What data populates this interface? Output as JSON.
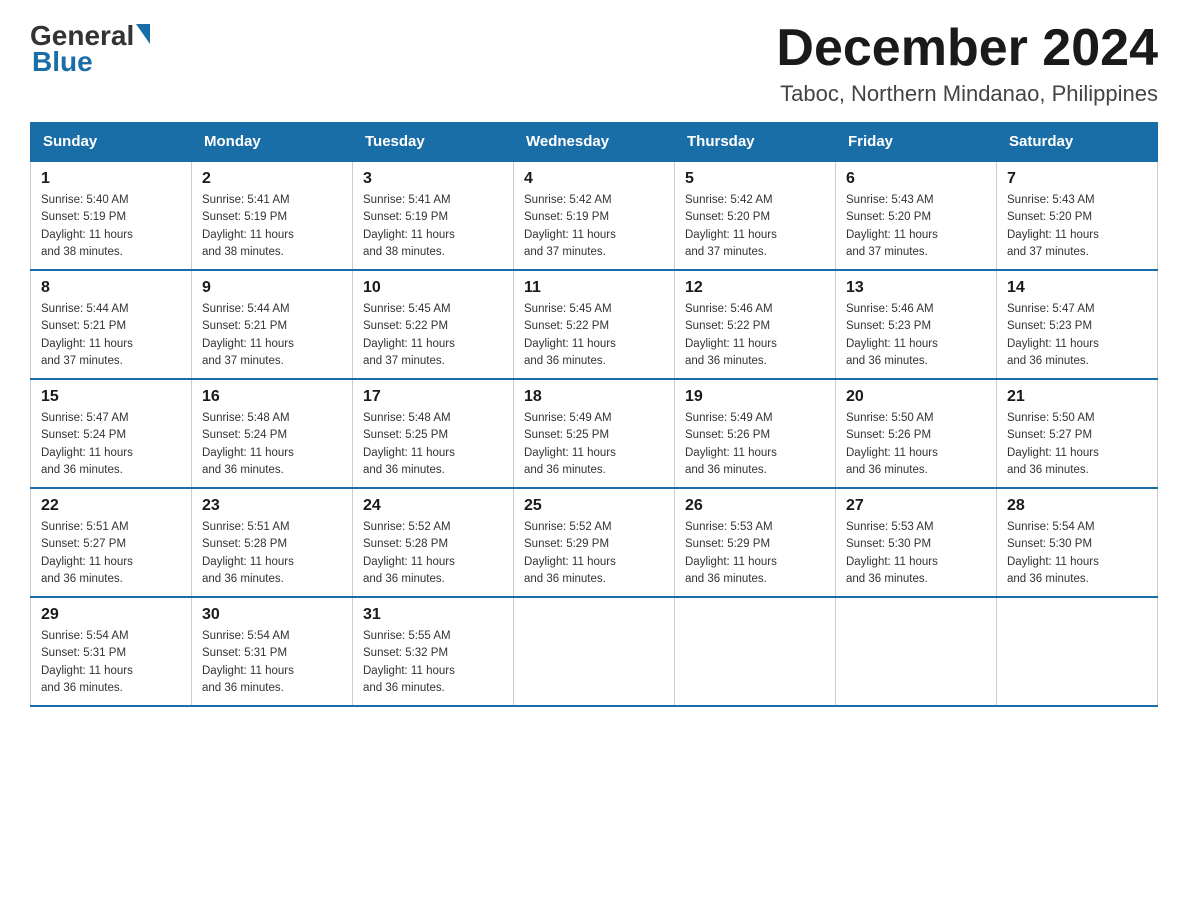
{
  "header": {
    "logo": {
      "general": "General",
      "blue": "Blue"
    },
    "title": "December 2024",
    "subtitle": "Taboc, Northern Mindanao, Philippines"
  },
  "calendar": {
    "days_of_week": [
      "Sunday",
      "Monday",
      "Tuesday",
      "Wednesday",
      "Thursday",
      "Friday",
      "Saturday"
    ],
    "weeks": [
      [
        {
          "day": "1",
          "sunrise": "5:40 AM",
          "sunset": "5:19 PM",
          "daylight": "11 hours and 38 minutes."
        },
        {
          "day": "2",
          "sunrise": "5:41 AM",
          "sunset": "5:19 PM",
          "daylight": "11 hours and 38 minutes."
        },
        {
          "day": "3",
          "sunrise": "5:41 AM",
          "sunset": "5:19 PM",
          "daylight": "11 hours and 38 minutes."
        },
        {
          "day": "4",
          "sunrise": "5:42 AM",
          "sunset": "5:19 PM",
          "daylight": "11 hours and 37 minutes."
        },
        {
          "day": "5",
          "sunrise": "5:42 AM",
          "sunset": "5:20 PM",
          "daylight": "11 hours and 37 minutes."
        },
        {
          "day": "6",
          "sunrise": "5:43 AM",
          "sunset": "5:20 PM",
          "daylight": "11 hours and 37 minutes."
        },
        {
          "day": "7",
          "sunrise": "5:43 AM",
          "sunset": "5:20 PM",
          "daylight": "11 hours and 37 minutes."
        }
      ],
      [
        {
          "day": "8",
          "sunrise": "5:44 AM",
          "sunset": "5:21 PM",
          "daylight": "11 hours and 37 minutes."
        },
        {
          "day": "9",
          "sunrise": "5:44 AM",
          "sunset": "5:21 PM",
          "daylight": "11 hours and 37 minutes."
        },
        {
          "day": "10",
          "sunrise": "5:45 AM",
          "sunset": "5:22 PM",
          "daylight": "11 hours and 37 minutes."
        },
        {
          "day": "11",
          "sunrise": "5:45 AM",
          "sunset": "5:22 PM",
          "daylight": "11 hours and 36 minutes."
        },
        {
          "day": "12",
          "sunrise": "5:46 AM",
          "sunset": "5:22 PM",
          "daylight": "11 hours and 36 minutes."
        },
        {
          "day": "13",
          "sunrise": "5:46 AM",
          "sunset": "5:23 PM",
          "daylight": "11 hours and 36 minutes."
        },
        {
          "day": "14",
          "sunrise": "5:47 AM",
          "sunset": "5:23 PM",
          "daylight": "11 hours and 36 minutes."
        }
      ],
      [
        {
          "day": "15",
          "sunrise": "5:47 AM",
          "sunset": "5:24 PM",
          "daylight": "11 hours and 36 minutes."
        },
        {
          "day": "16",
          "sunrise": "5:48 AM",
          "sunset": "5:24 PM",
          "daylight": "11 hours and 36 minutes."
        },
        {
          "day": "17",
          "sunrise": "5:48 AM",
          "sunset": "5:25 PM",
          "daylight": "11 hours and 36 minutes."
        },
        {
          "day": "18",
          "sunrise": "5:49 AM",
          "sunset": "5:25 PM",
          "daylight": "11 hours and 36 minutes."
        },
        {
          "day": "19",
          "sunrise": "5:49 AM",
          "sunset": "5:26 PM",
          "daylight": "11 hours and 36 minutes."
        },
        {
          "day": "20",
          "sunrise": "5:50 AM",
          "sunset": "5:26 PM",
          "daylight": "11 hours and 36 minutes."
        },
        {
          "day": "21",
          "sunrise": "5:50 AM",
          "sunset": "5:27 PM",
          "daylight": "11 hours and 36 minutes."
        }
      ],
      [
        {
          "day": "22",
          "sunrise": "5:51 AM",
          "sunset": "5:27 PM",
          "daylight": "11 hours and 36 minutes."
        },
        {
          "day": "23",
          "sunrise": "5:51 AM",
          "sunset": "5:28 PM",
          "daylight": "11 hours and 36 minutes."
        },
        {
          "day": "24",
          "sunrise": "5:52 AM",
          "sunset": "5:28 PM",
          "daylight": "11 hours and 36 minutes."
        },
        {
          "day": "25",
          "sunrise": "5:52 AM",
          "sunset": "5:29 PM",
          "daylight": "11 hours and 36 minutes."
        },
        {
          "day": "26",
          "sunrise": "5:53 AM",
          "sunset": "5:29 PM",
          "daylight": "11 hours and 36 minutes."
        },
        {
          "day": "27",
          "sunrise": "5:53 AM",
          "sunset": "5:30 PM",
          "daylight": "11 hours and 36 minutes."
        },
        {
          "day": "28",
          "sunrise": "5:54 AM",
          "sunset": "5:30 PM",
          "daylight": "11 hours and 36 minutes."
        }
      ],
      [
        {
          "day": "29",
          "sunrise": "5:54 AM",
          "sunset": "5:31 PM",
          "daylight": "11 hours and 36 minutes."
        },
        {
          "day": "30",
          "sunrise": "5:54 AM",
          "sunset": "5:31 PM",
          "daylight": "11 hours and 36 minutes."
        },
        {
          "day": "31",
          "sunrise": "5:55 AM",
          "sunset": "5:32 PM",
          "daylight": "11 hours and 36 minutes."
        },
        null,
        null,
        null,
        null
      ]
    ],
    "labels": {
      "sunrise": "Sunrise:",
      "sunset": "Sunset:",
      "daylight": "Daylight:"
    }
  }
}
